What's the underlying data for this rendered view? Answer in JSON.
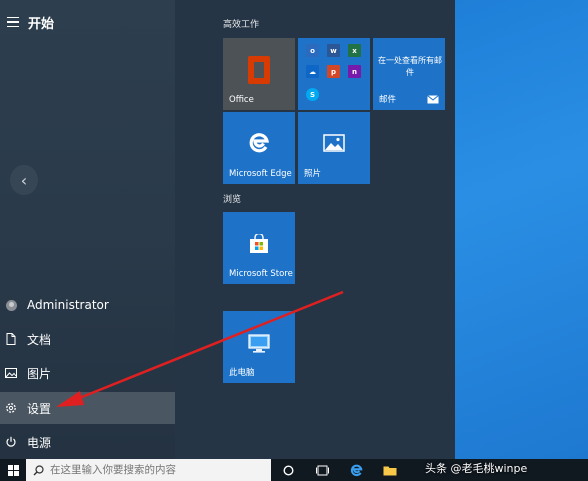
{
  "start_menu": {
    "title": "开始",
    "groups": {
      "productivity": "高效工作",
      "browse": "浏览"
    },
    "tiles": {
      "office": "Office",
      "mail_text": "在一处查看所有邮件",
      "mail_label": "邮件",
      "edge": "Microsoft Edge",
      "photos": "照片",
      "store": "Microsoft Store",
      "pc": "此电脑"
    },
    "rail": {
      "user": "Administrator",
      "documents": "文档",
      "pictures": "图片",
      "settings": "设置",
      "power": "电源"
    }
  },
  "taskbar": {
    "search_placeholder": "在这里输入你要搜索的内容"
  },
  "watermark": "头条 @老毛桃winpe",
  "colors": {
    "tile_blue": "#1e73c9",
    "office_red": "#d83b01",
    "arrow_red": "#e02020"
  }
}
